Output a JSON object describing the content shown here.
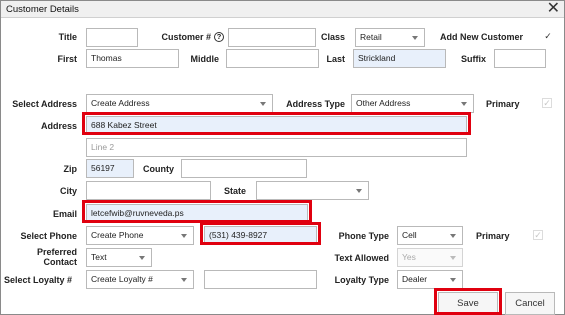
{
  "window": {
    "title": "Customer Details",
    "close_glyph": "✕"
  },
  "labels": {
    "title": "Title",
    "customer_no": "Customer #",
    "class": "Class",
    "add_new_customer": "Add New Customer",
    "first": "First",
    "middle": "Middle",
    "last": "Last",
    "suffix": "Suffix",
    "select_address": "Select Address",
    "address_type": "Address Type",
    "primary": "Primary",
    "address": "Address",
    "zip": "Zip",
    "county": "County",
    "city": "City",
    "state": "State",
    "email": "Email",
    "select_phone": "Select Phone",
    "phone_type": "Phone Type",
    "preferred_contact_1": "Preferred",
    "preferred_contact_2": "Contact",
    "text_allowed": "Text Allowed",
    "select_loyalty": "Select Loyalty #",
    "loyalty_type": "Loyalty Type"
  },
  "fields": {
    "title": "",
    "customer_no": "",
    "class": "Retail",
    "add_new_customer_checked": "✓",
    "first": "Thomas",
    "middle": "",
    "last": "Strickland",
    "suffix": "",
    "select_address": "Create Address",
    "address_type": "Other Address",
    "address_primary": "✓",
    "address_line1": "688 Kabez Street",
    "address_line2_placeholder": "Line 2",
    "zip": "56197",
    "county": "",
    "city": "",
    "state": "",
    "email": "letcefwib@ruvneveda.ps",
    "select_phone": "Create Phone",
    "phone": "(531) 439-8927",
    "phone_type": "Cell",
    "phone_primary": "✓",
    "preferred_contact": "Text",
    "text_allowed": "Yes",
    "select_loyalty": "Create Loyalty #",
    "loyalty_no": "",
    "loyalty_type": "Dealer"
  },
  "buttons": {
    "save": "Save",
    "cancel": "Cancel"
  },
  "icons": {
    "help": "?"
  },
  "colors": {
    "highlight": "#e0000f",
    "prefilled_bg": "#e8f0fb"
  }
}
